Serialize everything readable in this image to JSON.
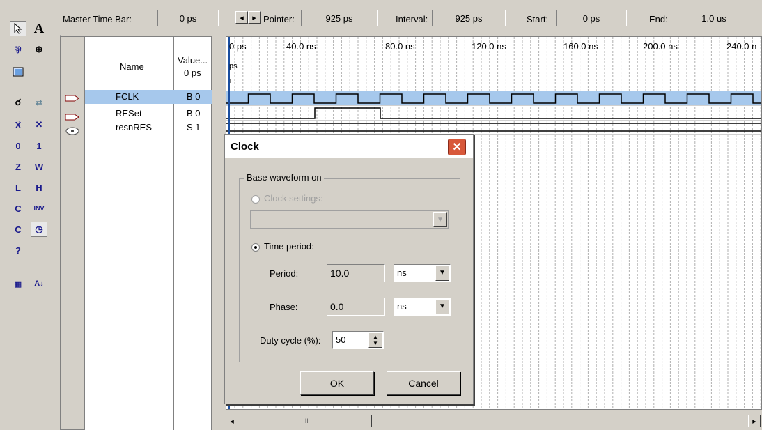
{
  "topbar": {
    "master_time_bar_label": "Master Time Bar:",
    "master_time_bar_value": "0 ps",
    "pointer_label": "Pointer:",
    "pointer_value": "925 ps",
    "interval_label": "Interval:",
    "interval_value": "925 ps",
    "start_label": "Start:",
    "start_value": "0 ps",
    "end_label": "End:",
    "end_value": "1.0 us"
  },
  "table": {
    "name_header": "Name",
    "value_header_line1": "Value...",
    "value_header_line2": "0 ps",
    "rows": [
      {
        "name": "FCLK",
        "value": "B 0"
      },
      {
        "name": "RESet",
        "value": "B 0"
      },
      {
        "name": "resnRES",
        "value": "S 1"
      }
    ]
  },
  "timeline": {
    "ticks": [
      "0 ps",
      "40.0 ns",
      "80.0 ns",
      "120.0 ns",
      "160.0 ns",
      "200.0 ns",
      "240.0 n"
    ],
    "cursor_label": "ps"
  },
  "dialog": {
    "title": "Clock",
    "group_label": "Base waveform on",
    "clock_settings_label": "Clock settings:",
    "time_period_label": "Time period:",
    "period_label": "Period:",
    "period_value": "10.0",
    "period_unit": "ns",
    "phase_label": "Phase:",
    "phase_value": "0.0",
    "phase_unit": "ns",
    "duty_label": "Duty cycle (%):",
    "duty_value": "50",
    "ok_label": "OK",
    "cancel_label": "Cancel"
  },
  "scroll": {
    "thumb_grip": "III"
  }
}
